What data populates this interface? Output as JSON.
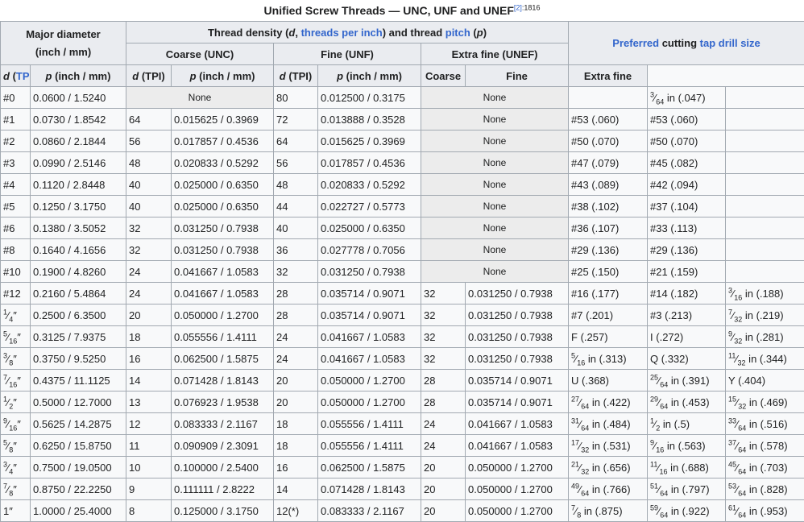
{
  "caption": {
    "title": "Unified Screw Threads — UNC, UNF and UNEF",
    "ref": "[2]",
    "page": ":1816"
  },
  "headers": {
    "major_diameter_l1": "Major diameter",
    "major_diameter_l2": "(inch / mm)",
    "thread_density": {
      "p1": "Thread density (",
      "d": "d",
      "comma": ", ",
      "tpi_link": "threads per inch",
      "p2": ") and thread ",
      "pitch_link": "pitch",
      "p3": " (",
      "p": "p",
      "p4": ")"
    },
    "preferred": {
      "preferred_link": "Preferred",
      "mid": " cutting ",
      "tap_link": "tap drill size"
    },
    "coarse_unc": "Coarse (UNC)",
    "fine_unf": "Fine (UNF)",
    "extra_fine_unef": "Extra fine (UNEF)",
    "d_pre": "d (",
    "d_tpi": "TPI",
    "d_post": ")",
    "p_label": "p",
    "p_unit": " (inch / mm)",
    "drill_coarse": "Coarse",
    "drill_fine": "Fine",
    "drill_extra_fine": "Extra fine"
  },
  "none_label": "None",
  "rows": [
    {
      "size": "#0",
      "dia": "0.0600 / 1.5240",
      "c_tpi": "",
      "c_p": "",
      "f_tpi": "80",
      "f_p": "0.012500 / 0.3175",
      "e_tpi": "",
      "e_p": "",
      "dc": "",
      "df": {
        "n": "3",
        "d": "64",
        "rest": " in (.047)"
      },
      "de": ""
    },
    {
      "size": "#1",
      "dia": "0.0730 / 1.8542",
      "c_tpi": "64",
      "c_p": "0.015625 / 0.3969",
      "f_tpi": "72",
      "f_p": "0.013888 / 0.3528",
      "e_tpi": "",
      "e_p": "",
      "dc": "#53 (.060)",
      "df": "#53 (.060)",
      "de": ""
    },
    {
      "size": "#2",
      "dia": "0.0860 / 2.1844",
      "c_tpi": "56",
      "c_p": "0.017857 / 0.4536",
      "f_tpi": "64",
      "f_p": "0.015625 / 0.3969",
      "e_tpi": "",
      "e_p": "",
      "dc": "#50 (.070)",
      "df": "#50 (.070)",
      "de": ""
    },
    {
      "size": "#3",
      "dia": "0.0990 / 2.5146",
      "c_tpi": "48",
      "c_p": "0.020833 / 0.5292",
      "f_tpi": "56",
      "f_p": "0.017857 / 0.4536",
      "e_tpi": "",
      "e_p": "",
      "dc": "#47 (.079)",
      "df": "#45 (.082)",
      "de": ""
    },
    {
      "size": "#4",
      "dia": "0.1120 / 2.8448",
      "c_tpi": "40",
      "c_p": "0.025000 / 0.6350",
      "f_tpi": "48",
      "f_p": "0.020833 / 0.5292",
      "e_tpi": "",
      "e_p": "",
      "dc": "#43 (.089)",
      "df": "#42 (.094)",
      "de": ""
    },
    {
      "size": "#5",
      "dia": "0.1250 / 3.1750",
      "c_tpi": "40",
      "c_p": "0.025000 / 0.6350",
      "f_tpi": "44",
      "f_p": "0.022727 / 0.5773",
      "e_tpi": "",
      "e_p": "",
      "dc": "#38 (.102)",
      "df": "#37 (.104)",
      "de": ""
    },
    {
      "size": "#6",
      "dia": "0.1380 / 3.5052",
      "c_tpi": "32",
      "c_p": "0.031250 / 0.7938",
      "f_tpi": "40",
      "f_p": "0.025000 / 0.6350",
      "e_tpi": "",
      "e_p": "",
      "dc": "#36 (.107)",
      "df": "#33 (.113)",
      "de": ""
    },
    {
      "size": "#8",
      "dia": "0.1640 / 4.1656",
      "c_tpi": "32",
      "c_p": "0.031250 / 0.7938",
      "f_tpi": "36",
      "f_p": "0.027778 / 0.7056",
      "e_tpi": "",
      "e_p": "",
      "dc": "#29 (.136)",
      "df": "#29 (.136)",
      "de": ""
    },
    {
      "size": "#10",
      "dia": "0.1900 / 4.8260",
      "c_tpi": "24",
      "c_p": "0.041667 / 1.0583",
      "f_tpi": "32",
      "f_p": "0.031250 / 0.7938",
      "e_tpi": "",
      "e_p": "",
      "dc": "#25 (.150)",
      "df": "#21 (.159)",
      "de": ""
    },
    {
      "size": "#12",
      "dia": "0.2160 / 5.4864",
      "c_tpi": "24",
      "c_p": "0.041667 / 1.0583",
      "f_tpi": "28",
      "f_p": "0.035714 / 0.9071",
      "e_tpi": "32",
      "e_p": "0.031250 / 0.7938",
      "dc": "#16 (.177)",
      "df": "#14 (.182)",
      "de": {
        "n": "3",
        "d": "16",
        "rest": " in (.188)"
      }
    },
    {
      "size": {
        "n": "1",
        "d": "4",
        "rest": "″"
      },
      "dia": "0.2500 / 6.3500",
      "c_tpi": "20",
      "c_p": "0.050000 / 1.2700",
      "f_tpi": "28",
      "f_p": "0.035714 / 0.9071",
      "e_tpi": "32",
      "e_p": "0.031250 / 0.7938",
      "dc": "#7 (.201)",
      "df": "#3 (.213)",
      "de": {
        "n": "7",
        "d": "32",
        "rest": " in (.219)"
      }
    },
    {
      "size": {
        "n": "5",
        "d": "16",
        "rest": "″"
      },
      "dia": "0.3125 / 7.9375",
      "c_tpi": "18",
      "c_p": "0.055556 / 1.4111",
      "f_tpi": "24",
      "f_p": "0.041667 / 1.0583",
      "e_tpi": "32",
      "e_p": "0.031250 / 0.7938",
      "dc": "F (.257)",
      "df": "I (.272)",
      "de": {
        "n": "9",
        "d": "32",
        "rest": " in (.281)"
      }
    },
    {
      "size": {
        "n": "3",
        "d": "8",
        "rest": "″"
      },
      "dia": "0.3750 / 9.5250",
      "c_tpi": "16",
      "c_p": "0.062500 / 1.5875",
      "f_tpi": "24",
      "f_p": "0.041667 / 1.0583",
      "e_tpi": "32",
      "e_p": "0.031250 / 0.7938",
      "dc": {
        "n": "5",
        "d": "16",
        "rest": " in (.313)"
      },
      "df": "Q (.332)",
      "de": {
        "n": "11",
        "d": "32",
        "rest": " in (.344)"
      }
    },
    {
      "size": {
        "n": "7",
        "d": "16",
        "rest": "″"
      },
      "dia": "0.4375 / 11.1125",
      "c_tpi": "14",
      "c_p": "0.071428 / 1.8143",
      "f_tpi": "20",
      "f_p": "0.050000 / 1.2700",
      "e_tpi": "28",
      "e_p": "0.035714 / 0.9071",
      "dc": "U (.368)",
      "df": {
        "n": "25",
        "d": "64",
        "rest": " in (.391)"
      },
      "de": "Y (.404)"
    },
    {
      "size": {
        "n": "1",
        "d": "2",
        "rest": "″"
      },
      "dia": "0.5000 / 12.7000",
      "c_tpi": "13",
      "c_p": "0.076923 / 1.9538",
      "f_tpi": "20",
      "f_p": "0.050000 / 1.2700",
      "e_tpi": "28",
      "e_p": "0.035714 / 0.9071",
      "dc": {
        "n": "27",
        "d": "64",
        "rest": " in (.422)"
      },
      "df": {
        "n": "29",
        "d": "64",
        "rest": " in (.453)"
      },
      "de": {
        "n": "15",
        "d": "32",
        "rest": " in (.469)"
      }
    },
    {
      "size": {
        "n": "9",
        "d": "16",
        "rest": "″"
      },
      "dia": "0.5625 / 14.2875",
      "c_tpi": "12",
      "c_p": "0.083333 / 2.1167",
      "f_tpi": "18",
      "f_p": "0.055556 / 1.4111",
      "e_tpi": "24",
      "e_p": "0.041667 / 1.0583",
      "dc": {
        "n": "31",
        "d": "64",
        "rest": " in (.484)"
      },
      "df": {
        "n": "1",
        "d": "2",
        "rest": " in (.5)"
      },
      "de": {
        "n": "33",
        "d": "64",
        "rest": " in (.516)"
      }
    },
    {
      "size": {
        "n": "5",
        "d": "8",
        "rest": "″"
      },
      "dia": "0.6250 / 15.8750",
      "c_tpi": "11",
      "c_p": "0.090909 / 2.3091",
      "f_tpi": "18",
      "f_p": "0.055556 / 1.4111",
      "e_tpi": "24",
      "e_p": "0.041667 / 1.0583",
      "dc": {
        "n": "17",
        "d": "32",
        "rest": " in (.531)"
      },
      "df": {
        "n": "9",
        "d": "16",
        "rest": " in (.563)"
      },
      "de": {
        "n": "37",
        "d": "64",
        "rest": " in (.578)"
      }
    },
    {
      "size": {
        "n": "3",
        "d": "4",
        "rest": "″"
      },
      "dia": "0.7500 / 19.0500",
      "c_tpi": "10",
      "c_p": "0.100000 / 2.5400",
      "f_tpi": "16",
      "f_p": "0.062500 / 1.5875",
      "e_tpi": "20",
      "e_p": "0.050000 / 1.2700",
      "dc": {
        "n": "21",
        "d": "32",
        "rest": " in (.656)"
      },
      "df": {
        "n": "11",
        "d": "16",
        "rest": " in (.688)"
      },
      "de": {
        "n": "45",
        "d": "64",
        "rest": " in (.703)"
      }
    },
    {
      "size": {
        "n": "7",
        "d": "8",
        "rest": "″"
      },
      "dia": "0.8750 / 22.2250",
      "c_tpi": "9",
      "c_p": "0.111111 / 2.8222",
      "f_tpi": "14",
      "f_p": "0.071428 / 1.8143",
      "e_tpi": "20",
      "e_p": "0.050000 / 1.2700",
      "dc": {
        "n": "49",
        "d": "64",
        "rest": " in (.766)"
      },
      "df": {
        "n": "51",
        "d": "64",
        "rest": " in (.797)"
      },
      "de": {
        "n": "53",
        "d": "64",
        "rest": " in (.828)"
      }
    },
    {
      "size": "1″",
      "dia": "1.0000 / 25.4000",
      "c_tpi": "8",
      "c_p": "0.125000 / 3.1750",
      "f_tpi": "12(*)",
      "f_p": "0.083333 / 2.1167",
      "e_tpi": "20",
      "e_p": "0.050000 / 1.2700",
      "dc": {
        "n": "7",
        "d": "8",
        "rest": " in (.875)"
      },
      "df": {
        "n": "59",
        "d": "64",
        "rest": " in (.922)"
      },
      "de": {
        "n": "61",
        "d": "64",
        "rest": " in (.953)"
      }
    }
  ]
}
